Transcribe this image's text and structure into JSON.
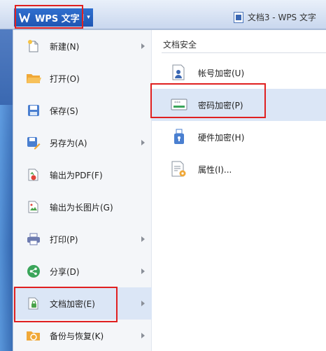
{
  "app": {
    "name": "WPS 文字",
    "caret": "▾"
  },
  "window": {
    "document_title": "文档3 - WPS 文字"
  },
  "menu_items": [
    {
      "label": "新建(N)",
      "icon": "new-doc-icon",
      "submenu": true
    },
    {
      "label": "打开(O)",
      "icon": "folder-open-icon",
      "submenu": false
    },
    {
      "label": "保存(S)",
      "icon": "save-icon",
      "submenu": false
    },
    {
      "label": "另存为(A)",
      "icon": "save-as-icon",
      "submenu": true
    },
    {
      "label": "输出为PDF(F)",
      "icon": "pdf-export-icon",
      "submenu": false
    },
    {
      "label": "输出为长图片(G)",
      "icon": "image-export-icon",
      "submenu": false
    },
    {
      "label": "打印(P)",
      "icon": "printer-icon",
      "submenu": true
    },
    {
      "label": "分享(D)",
      "icon": "share-icon",
      "submenu": true
    },
    {
      "label": "文档加密(E)",
      "icon": "doc-encrypt-icon",
      "submenu": true,
      "active": true
    },
    {
      "label": "备份与恢复(K)",
      "icon": "backup-restore-icon",
      "submenu": true
    }
  ],
  "submenu": {
    "title": "文档安全",
    "items": [
      {
        "label": "帐号加密(U)",
        "icon": "account-lock-icon"
      },
      {
        "label": "密码加密(P)",
        "icon": "password-lock-icon",
        "active": true
      },
      {
        "label": "硬件加密(H)",
        "icon": "usb-key-icon"
      },
      {
        "label": "属性(I)...",
        "icon": "properties-icon"
      }
    ]
  },
  "colors": {
    "accent": "#1f56b3",
    "highlight": "#e02020",
    "active_bg": "#dbe6f6"
  }
}
